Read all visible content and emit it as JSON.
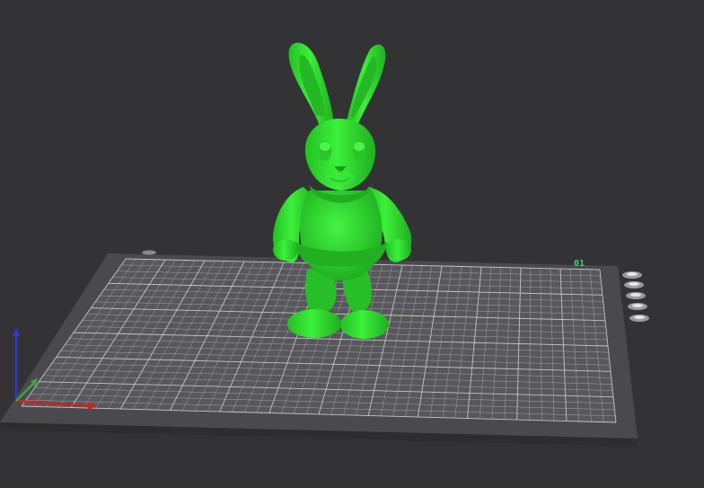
{
  "viewport": {
    "background": "#333335"
  },
  "build_plate": {
    "label": "01",
    "label_color": "#3ed36b",
    "grid_color": "#d0d0d4",
    "plate_color": "#4a4a4e",
    "bed_color": "#58585c"
  },
  "model": {
    "name": "bunny",
    "color": "#33e632"
  },
  "axes": {
    "x_color": "#d02020",
    "y_color": "#3aa83a",
    "z_color": "#2a3ad0"
  },
  "plate_tool_icons": [
    "orient-icon",
    "arrange-icon",
    "lock-icon",
    "edit-icon",
    "settings-icon"
  ]
}
